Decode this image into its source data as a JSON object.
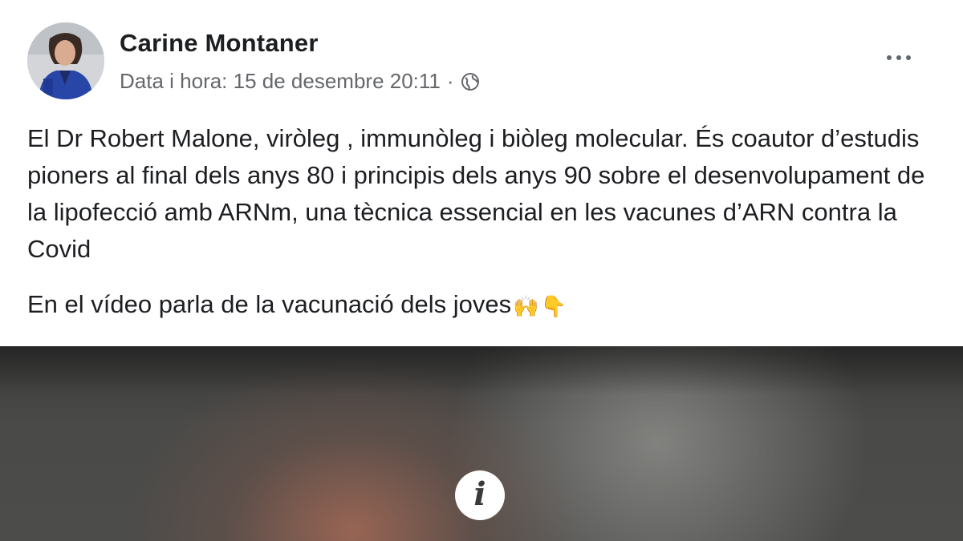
{
  "post": {
    "author": "Carine Montaner",
    "timestamp": "Data i hora: 15 de desembre 20:11",
    "separator": "·",
    "audience_icon": "globe-icon",
    "more_icon": "more-options-icon",
    "paragraphs": [
      "El Dr Robert Malone, viròleg , immunòleg i biòleg molecular. És coautor d’estudis pioners al final dels anys 80 i principis dels anys 90 sobre el desenvolupament de la lipofecció amb ARNm, una tècnica essencial en les vacunes d’ARN contra la Covid",
      "En el vídeo parla de la vacunació dels joves"
    ],
    "emojis": [
      "🙌",
      "👇"
    ]
  },
  "video": {
    "overlay_icon": "info-icon",
    "overlay_glyph": "i"
  },
  "colors": {
    "author_text": "#1c1e21",
    "meta_text": "#65676b",
    "body_text": "#1c1e21"
  }
}
